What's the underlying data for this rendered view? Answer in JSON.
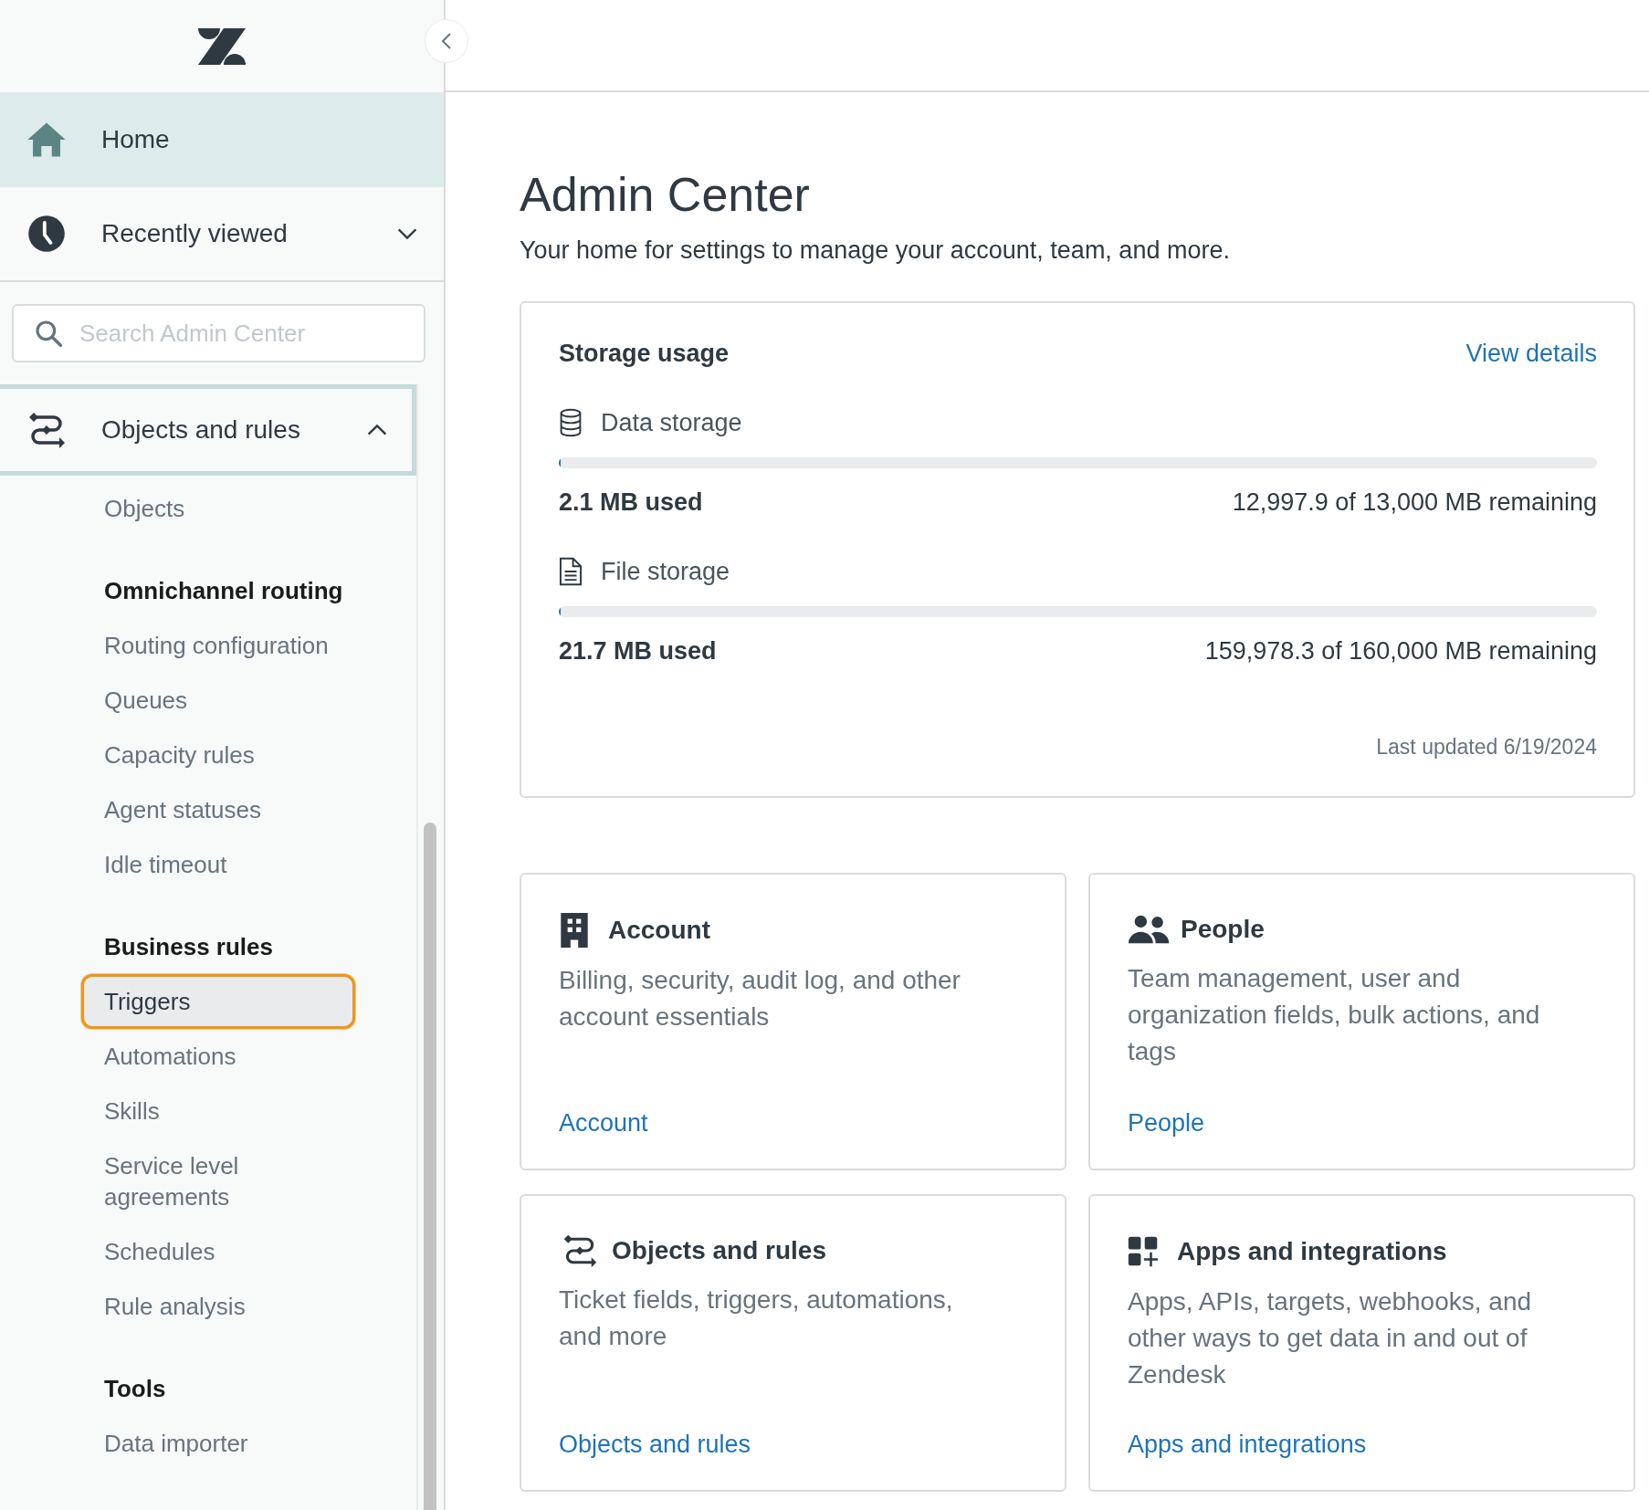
{
  "nav": [
    {
      "kind": "home",
      "label": "Home",
      "selected": true
    },
    {
      "kind": "clock",
      "label": "Recently viewed",
      "selected": false,
      "expanded": false
    }
  ],
  "search": {
    "placeholder": "Search Admin Center"
  },
  "section": {
    "label": "Objects and rules",
    "expanded": true,
    "items": [
      {
        "kind": "link",
        "label": "Objects",
        "selected": false
      },
      {
        "kind": "heading",
        "label": "Omnichannel routing"
      },
      {
        "kind": "link",
        "label": "Routing configuration",
        "selected": false
      },
      {
        "kind": "link",
        "label": "Queues",
        "selected": false
      },
      {
        "kind": "link",
        "label": "Capacity rules",
        "selected": false
      },
      {
        "kind": "link",
        "label": "Agent statuses",
        "selected": false
      },
      {
        "kind": "link",
        "label": "Idle timeout",
        "selected": false
      },
      {
        "kind": "heading",
        "label": "Business rules"
      },
      {
        "kind": "link",
        "label": "Triggers",
        "selected": true
      },
      {
        "kind": "link",
        "label": "Automations",
        "selected": false
      },
      {
        "kind": "link",
        "label": "Skills",
        "selected": false
      },
      {
        "kind": "link",
        "label": "Service level agreements",
        "selected": false
      },
      {
        "kind": "link",
        "label": "Schedules",
        "selected": false
      },
      {
        "kind": "link",
        "label": "Rule analysis",
        "selected": false
      },
      {
        "kind": "heading",
        "label": "Tools"
      },
      {
        "kind": "link",
        "label": "Data importer",
        "selected": false
      }
    ]
  },
  "page": {
    "title": "Admin Center",
    "subtitle": "Your home for settings to manage your account, team, and more."
  },
  "storage": {
    "title": "Storage usage",
    "link": "View details",
    "meters": [
      {
        "kind": "database",
        "label": "Data storage",
        "level": 0.00016,
        "used": "2.1 MB used",
        "remaining": "12,997.9 of 13,000 MB remaining"
      },
      {
        "kind": "document",
        "label": "File storage",
        "level": 0.00014,
        "used": "21.7 MB used",
        "remaining": "159,978.3 of 160,000 MB remaining"
      }
    ],
    "updated": "Last updated 6/19/2024"
  },
  "cards": [
    {
      "kind": "building",
      "title": "Account",
      "description": "Billing, security, audit log, and other account essentials",
      "link": "Account"
    },
    {
      "kind": "people",
      "title": "People",
      "description": "Team management, user and organization fields, bulk actions, and tags",
      "link": "People"
    },
    {
      "kind": "routes",
      "title": "Objects and rules",
      "description": "Ticket fields, triggers, automations, and more",
      "link": "Objects and rules"
    },
    {
      "kind": "apps",
      "title": "Apps and integrations",
      "description": "Apps, APIs, targets, webhooks, and other ways to get data in and out of Zendesk",
      "link": "Apps and integrations"
    }
  ]
}
